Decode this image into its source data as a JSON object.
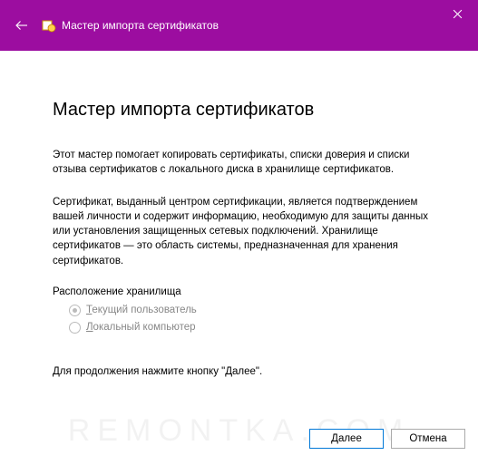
{
  "titlebar": {
    "title": "Мастер импорта сертификатов"
  },
  "heading": "Мастер импорта сертификатов",
  "intro": "Этот мастер помогает копировать сертификаты, списки доверия и списки отзыва сертификатов с локального диска в хранилище сертификатов.",
  "desc": "Сертификат, выданный центром сертификации, является подтверждением вашей личности и содержит информацию, необходимую для защиты данных или установления защищенных сетевых подключений. Хранилище сертификатов — это область системы, предназначенная для хранения сертификатов.",
  "storage": {
    "label": "Расположение хранилища",
    "options": [
      {
        "prefix": "Т",
        "rest": "екущий пользователь",
        "selected": true
      },
      {
        "prefix": "Л",
        "rest": "окальный компьютер",
        "selected": false
      }
    ]
  },
  "continue_hint": "Для продолжения нажмите кнопку \"Далее\".",
  "buttons": {
    "next": "Далее",
    "cancel": "Отмена"
  },
  "watermark": "REMONTKA.COM"
}
